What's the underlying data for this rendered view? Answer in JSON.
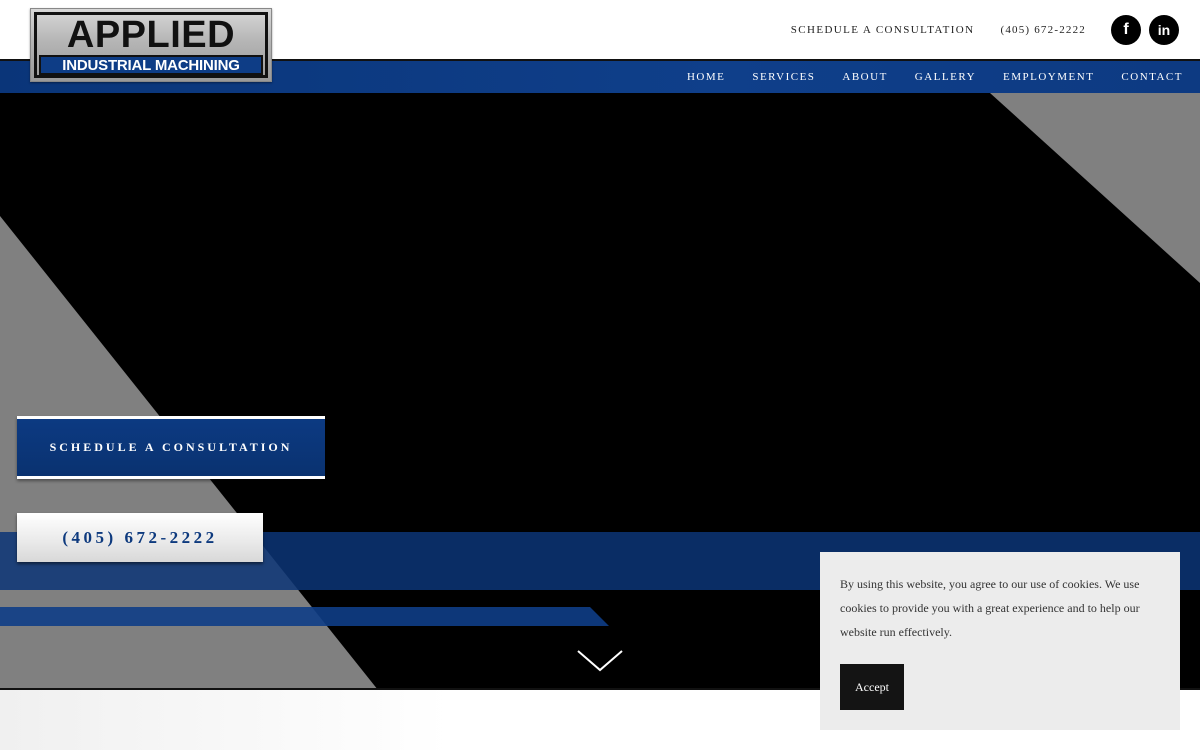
{
  "logo": {
    "word": "APPLIED",
    "subtitle": "INDUSTRIAL MACHINING"
  },
  "header": {
    "schedule_link": "SCHEDULE A CONSULTATION",
    "phone": "(405) 672-2222",
    "social": [
      {
        "icon": "facebook-icon",
        "glyph": "f"
      },
      {
        "icon": "linkedin-icon",
        "glyph": "in"
      }
    ]
  },
  "nav": {
    "items": [
      "HOME",
      "SERVICES",
      "ABOUT",
      "GALLERY",
      "EMPLOYMENT",
      "CONTACT"
    ]
  },
  "hero": {
    "cta_consult": "SCHEDULE A CONSULTATION",
    "cta_phone": "(405) 672-2222",
    "scroll_icon": "chevron-down-icon"
  },
  "cookie": {
    "text": "By using this website, you agree to our use of cookies. We use cookies to provide you with a great experience and to help our website run effectively.",
    "accept_label": "Accept"
  },
  "colors": {
    "brand_blue": "#0e3d86",
    "hero_bg": "#000000",
    "stripe_gray": "#808080",
    "cookie_bg": "#ececec"
  }
}
